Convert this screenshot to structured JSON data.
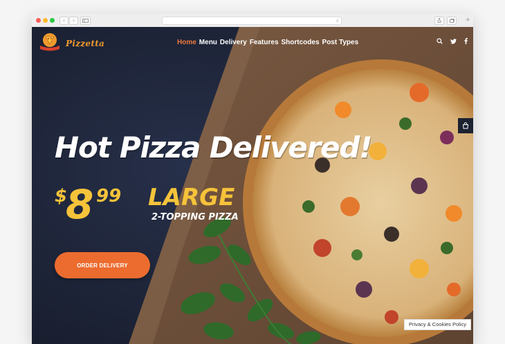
{
  "browser": {
    "back": "‹",
    "forward": "›",
    "reload": "c",
    "new_tab": "+"
  },
  "site": {
    "brand": "Pizzetta",
    "logo_text": "PIZZA"
  },
  "nav": {
    "items": [
      {
        "label": "Home",
        "active": true
      },
      {
        "label": "Menu",
        "active": false
      },
      {
        "label": "Delivery",
        "active": false
      },
      {
        "label": "Features",
        "active": false
      },
      {
        "label": "Shortcodes",
        "active": false
      },
      {
        "label": "Post Types",
        "active": false
      }
    ]
  },
  "header_icons": [
    "search-icon",
    "twitter-icon",
    "facebook-icon"
  ],
  "hero": {
    "headline": "Hot Pizza Delivered!",
    "currency": "$",
    "price_whole": "8",
    "price_cents": "99",
    "size": "LARGE",
    "subtitle": "2-TOPPING PIZZA",
    "cta": "ORDER DELIVERY"
  },
  "cookie_notice": "Privacy & Cookies Policy",
  "colors": {
    "accent": "#ee7a3d",
    "price": "#f5c33a",
    "button": "#ec6c2f",
    "background": "#1e2538",
    "brand": "#f09a2d"
  }
}
